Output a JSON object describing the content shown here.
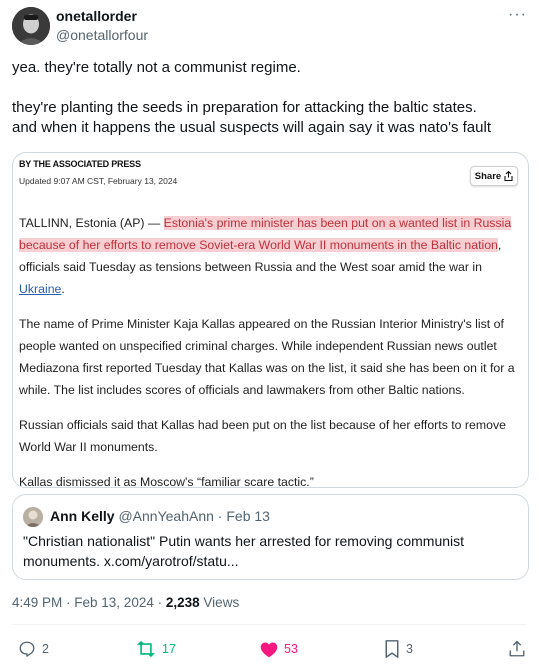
{
  "author": {
    "name": "onetallorder",
    "handle": "@onetallorfour"
  },
  "more_label": "···",
  "tweet": {
    "line1": "yea. they're totally not a communist regime.",
    "line2": "they're planting the seeds in preparation for attacking the baltic states.",
    "line3": "and when it happens the usual suspects will again say it was nato's fault"
  },
  "article": {
    "byline": "BY THE ASSOCIATED PRESS",
    "updated": "Updated 9:07 AM CST, February 13, 2024",
    "share_label": "Share",
    "p1_lead": "TALLINN, Estonia (AP) — ",
    "p1_highlight": "Estonia's prime minister has been put on a wanted list in Russia because of her efforts to remove Soviet-era World War II monuments in the Baltic nation",
    "p1_rest": ", officials said Tuesday as tensions between Russia and the West soar amid the war in ",
    "p1_link": "Ukraine",
    "p1_end": ".",
    "p2": "The name of Prime Minister Kaja Kallas appeared on the Russian Interior Ministry's list of people wanted on unspecified criminal charges. While independent Russian news outlet Mediazona first reported Tuesday that Kallas was on the list, it said she has been on it for a while. The list includes scores of officials and lawmakers from other Baltic nations.",
    "p3": "Russian officials said that Kallas had been put on the list because of her efforts to remove World War II monuments.",
    "p4": "Kallas dismissed it as Moscow's “familiar scare tactic.”"
  },
  "quote": {
    "name": "Ann Kelly",
    "handle": "@AnnYeahAnn",
    "separator": " · ",
    "date": "Feb 13",
    "text": "\"Christian nationalist\" Putin wants her arrested for removing communist monuments. x.com/yarotrof/statu..."
  },
  "meta": {
    "time": "4:49 PM",
    "separator": " · ",
    "date": "Feb 13, 2024",
    "views_count": "2,238",
    "views_label": "Views"
  },
  "actions": {
    "replies": "2",
    "retweets": "17",
    "likes": "53",
    "bookmarks": "3"
  },
  "colors": {
    "highlight_bg": "#f7cfd2",
    "highlight_text": "#c0303a",
    "retweet": "#00ba7c",
    "like": "#f91880",
    "secondary": "#536471"
  },
  "icons": {
    "reply": "reply-icon",
    "retweet": "retweet-icon",
    "like": "heart-filled-icon",
    "bookmark": "bookmark-icon",
    "share": "share-icon"
  }
}
